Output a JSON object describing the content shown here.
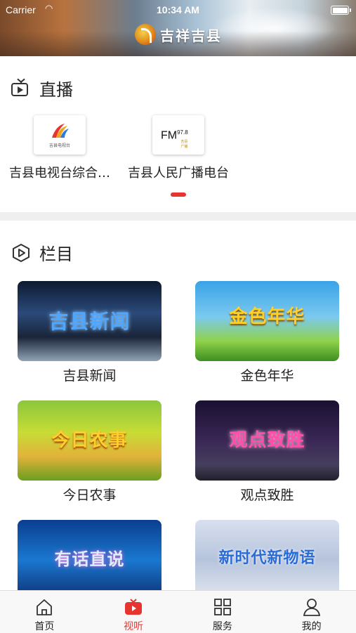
{
  "status_bar": {
    "carrier": "Carrier",
    "time": "10:34 AM",
    "wifi_icon": "wifi-icon",
    "battery_icon": "battery-icon"
  },
  "header": {
    "brand_text": "吉祥吉县",
    "logo_icon": "brand-logo-icon"
  },
  "live": {
    "title": "直播",
    "icon": "tv-icon",
    "channels": [
      {
        "name": "吉县电视台综合…",
        "logo_text": "吉县电视台"
      },
      {
        "name": "吉县人民广播电台",
        "logo_text": "FM",
        "logo_freq": "97.8",
        "logo_sub": "吉县广播"
      }
    ],
    "pager_active_color": "#e8342f"
  },
  "programs": {
    "title": "栏目",
    "icon": "hexagon-play-icon",
    "items": [
      {
        "label": "吉县新闻",
        "art_text": "吉县新闻"
      },
      {
        "label": "金色年华",
        "art_text": "金色年华"
      },
      {
        "label": "今日农事",
        "art_text": "今日农事"
      },
      {
        "label": "观点致胜",
        "art_text": "观点致胜"
      },
      {
        "label": "",
        "art_text": "有话直说"
      },
      {
        "label": "",
        "art_text": "新时代新物语"
      }
    ]
  },
  "tabbar": {
    "active_color": "#e8342f",
    "tabs": [
      {
        "label": "首页",
        "icon": "home-icon",
        "active": false
      },
      {
        "label": "视听",
        "icon": "tv-play-icon",
        "active": true
      },
      {
        "label": "服务",
        "icon": "grid-icon",
        "active": false
      },
      {
        "label": "我的",
        "icon": "user-icon",
        "active": false
      }
    ]
  }
}
